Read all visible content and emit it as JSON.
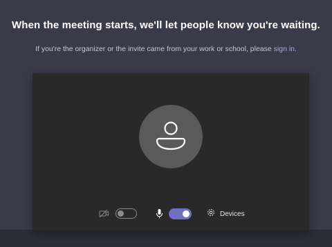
{
  "header": {
    "title": "When the meeting starts, we'll let people know you're waiting.",
    "subtitle_prefix": "If you're the organizer or the invite came from your work or school, please ",
    "sign_in_link": "sign in",
    "subtitle_suffix": "."
  },
  "preview": {
    "avatar_icon": "person-icon"
  },
  "controls": {
    "camera": {
      "icon": "camera-off-icon",
      "enabled": false
    },
    "microphone": {
      "icon": "microphone-icon",
      "enabled": true
    },
    "devices": {
      "icon": "gear-icon",
      "label": "Devices"
    }
  },
  "colors": {
    "background": "#3a3a49",
    "preview": "#292929",
    "avatar": "#5a5a5a",
    "accent": "#6f70c4",
    "link": "#a6a7dc"
  }
}
